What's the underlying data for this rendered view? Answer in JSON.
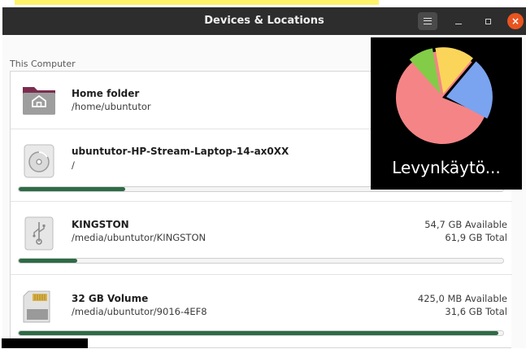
{
  "window": {
    "title": "Devices & Locations",
    "icons": {
      "menu": "hamburger-menu-icon",
      "minimize": "minimize-icon",
      "maximize": "maximize-icon",
      "close": "close-icon"
    },
    "close_symbol": "×"
  },
  "section": {
    "label": "This Computer"
  },
  "devices": [
    {
      "name": "Home folder",
      "path": "/home/ubuntutor",
      "icon": "home-folder-icon"
    },
    {
      "name": "ubuntutor-HP-Stream-Laptop-14-ax0XX",
      "path": "/",
      "icon": "hard-disk-icon",
      "usage_fraction": 0.22
    },
    {
      "name": "KINGSTON",
      "path": "/media/ubuntutor/KINGSTON",
      "available": "54,7 GB Available",
      "total": "61,9 GB Total",
      "icon": "usb-drive-icon",
      "usage_fraction": 0.12
    },
    {
      "name": "32 GB Volume",
      "path": "/media/ubuntutor/9016-4EF8",
      "available": "425,0 MB Available",
      "total": "31,6 GB Total",
      "icon": "sd-card-icon",
      "usage_fraction": 0.99
    }
  ],
  "overlay": {
    "label": "Levynkäytö...",
    "icon": "disk-usage-pie-chart-icon",
    "slice_colors": [
      "#f58487",
      "#7aa3f0",
      "#fad55a",
      "#83cc47"
    ]
  },
  "colors": {
    "titlebar": "#2d2d2d",
    "accent_close": "#e95420",
    "usage_bar": "#2e6b45"
  }
}
